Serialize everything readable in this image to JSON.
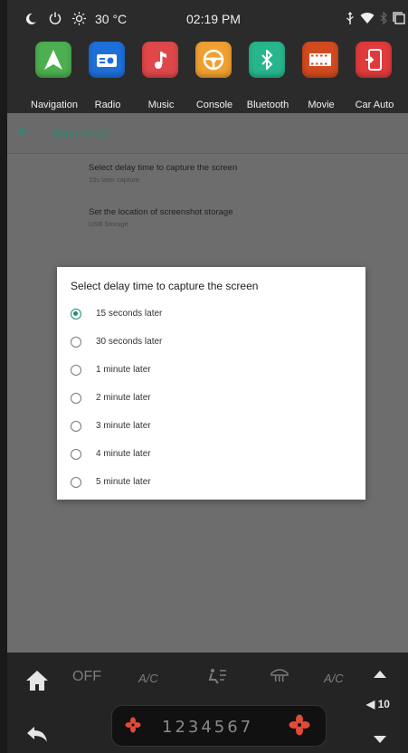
{
  "status_bar": {
    "temperature": "30 °C",
    "time": "02:19 PM"
  },
  "apps": [
    {
      "label": "Navigation",
      "icon": "navigation-arrow-icon",
      "color": "#4caf50"
    },
    {
      "label": "Radio",
      "icon": "radio-icon",
      "color": "#1e6fd9"
    },
    {
      "label": "Music",
      "icon": "music-note-icon",
      "color": "#e0474a"
    },
    {
      "label": "Console",
      "icon": "steering-wheel-icon",
      "color": "#f0a030"
    },
    {
      "label": "Bluetooth",
      "icon": "bluetooth-icon",
      "color": "#27b58d"
    },
    {
      "label": "Movie",
      "icon": "film-icon",
      "color": "#d24a1f"
    },
    {
      "label": "Car Auto",
      "icon": "phone-link-icon",
      "color": "#e03a3a"
    }
  ],
  "header": {
    "title": "Screenshot"
  },
  "settings": [
    {
      "title": "Select delay time to capture the screen",
      "subtitle": "15s later capture"
    },
    {
      "title": "Set the location of screenshot storage",
      "subtitle": "USB Storage"
    }
  ],
  "dialog": {
    "title": "Select delay time to capture the screen",
    "options": [
      "15 seconds later",
      "30 seconds later",
      "1 minute later",
      "2 minute later",
      "3 minute later",
      "4 minute later",
      "5 minute later"
    ],
    "selected_index": 0
  },
  "climate": {
    "off_label": "OFF",
    "ac_left": "A/C",
    "ac_right": "A/C",
    "fan_levels": "1234567",
    "volume": "10"
  },
  "colors": {
    "accent": "#1f8f76",
    "dialog_bg": "#ffffff",
    "dim_bg": "#6d6d6d"
  }
}
